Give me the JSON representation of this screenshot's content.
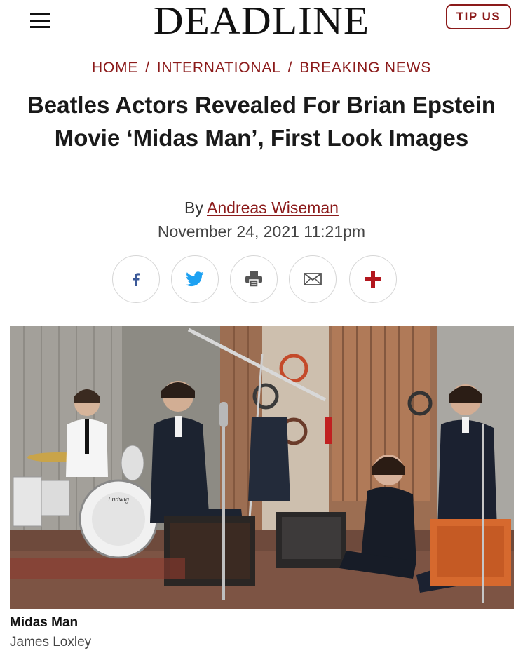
{
  "header": {
    "logo": "DEADLINE",
    "tip_label": "TIP US"
  },
  "breadcrumb": {
    "items": [
      "HOME",
      "INTERNATIONAL",
      "BREAKING NEWS"
    ],
    "separator": "/"
  },
  "article": {
    "title": "Beatles Actors Revealed For Brian Epstein Movie ‘Midas Man’, First Look Images",
    "by_prefix": "By",
    "author": "Andreas Wiseman",
    "date": "November 24, 2021 11:21pm"
  },
  "share": {
    "buttons": [
      {
        "icon": "facebook-icon",
        "color": "#3b5998"
      },
      {
        "icon": "twitter-icon",
        "color": "#1da1f2"
      },
      {
        "icon": "print-icon",
        "color": "#555555"
      },
      {
        "icon": "email-icon",
        "color": "#555555"
      },
      {
        "icon": "plus-icon",
        "color": "#b3171e"
      }
    ]
  },
  "photo": {
    "drum_brand": "Ludwig",
    "caption_title": "Midas Man",
    "caption_credit": "James Loxley"
  },
  "colors": {
    "brand_red": "#8b1a1a",
    "text_dark": "#1a1a1a"
  }
}
